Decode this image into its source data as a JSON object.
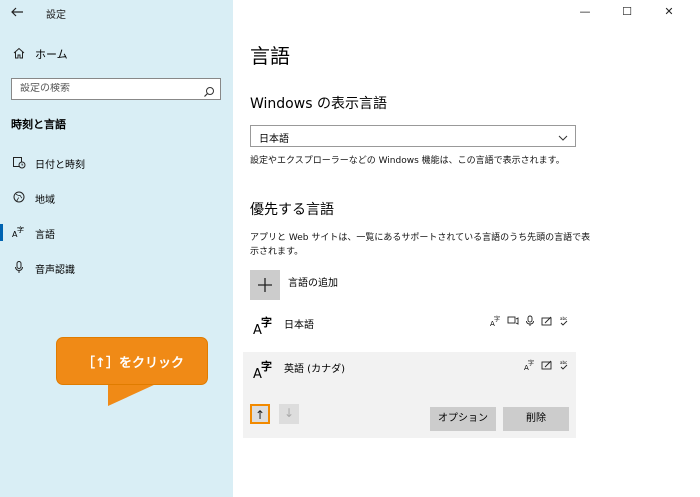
{
  "window": {
    "app_title": "設定",
    "minimize": "—",
    "maximize": "☐",
    "close": "✕"
  },
  "sidebar": {
    "home_label": "ホーム",
    "search_placeholder": "設定の検索",
    "section_title": "時刻と言語",
    "items": [
      {
        "label": "日付と時刻",
        "icon": "calendar-clock-icon"
      },
      {
        "label": "地域",
        "icon": "globe-icon"
      },
      {
        "label": "言語",
        "icon": "language-icon",
        "active": true
      },
      {
        "label": "音声認識",
        "icon": "microphone-icon"
      }
    ]
  },
  "main": {
    "page_title": "言語",
    "display_language_heading": "Windows の表示言語",
    "display_language_value": "日本語",
    "display_language_desc": "設定やエクスプローラーなどの Windows 機能は、この言語で表示されます。",
    "preferred_heading": "優先する言語",
    "preferred_desc_line1": "アプリと Web サイトは、一覧にあるサポートされている言語のうち先頭の言語で表",
    "preferred_desc_line2": "示されます。",
    "add_language_label": "言語の追加",
    "languages": [
      {
        "name": "日本語",
        "features": [
          "display-language-icon",
          "speech-icon",
          "microphone-icon",
          "handwriting-icon",
          "spellcheck-icon"
        ]
      },
      {
        "name": "英語 (カナダ)",
        "features": [
          "display-language-icon",
          "handwriting-icon",
          "spellcheck-icon"
        ]
      }
    ],
    "glyph_a": "A",
    "glyph_ji": "字",
    "spell_glyph": "abc",
    "up_arrow": "↑",
    "down_arrow": "↓",
    "options_button": "オプション",
    "delete_button": "削除"
  },
  "callout": {
    "text": "［↑］をクリック",
    "color": "#f08a16"
  }
}
